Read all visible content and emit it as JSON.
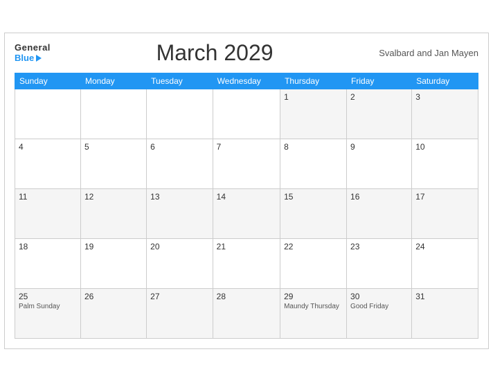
{
  "header": {
    "logo_general": "General",
    "logo_blue": "Blue",
    "title": "March 2029",
    "region": "Svalbard and Jan Mayen"
  },
  "weekdays": [
    "Sunday",
    "Monday",
    "Tuesday",
    "Wednesday",
    "Thursday",
    "Friday",
    "Saturday"
  ],
  "weeks": [
    [
      {
        "day": "",
        "event": ""
      },
      {
        "day": "",
        "event": ""
      },
      {
        "day": "",
        "event": ""
      },
      {
        "day": "",
        "event": ""
      },
      {
        "day": "1",
        "event": ""
      },
      {
        "day": "2",
        "event": ""
      },
      {
        "day": "3",
        "event": ""
      }
    ],
    [
      {
        "day": "4",
        "event": ""
      },
      {
        "day": "5",
        "event": ""
      },
      {
        "day": "6",
        "event": ""
      },
      {
        "day": "7",
        "event": ""
      },
      {
        "day": "8",
        "event": ""
      },
      {
        "day": "9",
        "event": ""
      },
      {
        "day": "10",
        "event": ""
      }
    ],
    [
      {
        "day": "11",
        "event": ""
      },
      {
        "day": "12",
        "event": ""
      },
      {
        "day": "13",
        "event": ""
      },
      {
        "day": "14",
        "event": ""
      },
      {
        "day": "15",
        "event": ""
      },
      {
        "day": "16",
        "event": ""
      },
      {
        "day": "17",
        "event": ""
      }
    ],
    [
      {
        "day": "18",
        "event": ""
      },
      {
        "day": "19",
        "event": ""
      },
      {
        "day": "20",
        "event": ""
      },
      {
        "day": "21",
        "event": ""
      },
      {
        "day": "22",
        "event": ""
      },
      {
        "day": "23",
        "event": ""
      },
      {
        "day": "24",
        "event": ""
      }
    ],
    [
      {
        "day": "25",
        "event": "Palm Sunday"
      },
      {
        "day": "26",
        "event": ""
      },
      {
        "day": "27",
        "event": ""
      },
      {
        "day": "28",
        "event": ""
      },
      {
        "day": "29",
        "event": "Maundy Thursday"
      },
      {
        "day": "30",
        "event": "Good Friday"
      },
      {
        "day": "31",
        "event": ""
      }
    ]
  ]
}
